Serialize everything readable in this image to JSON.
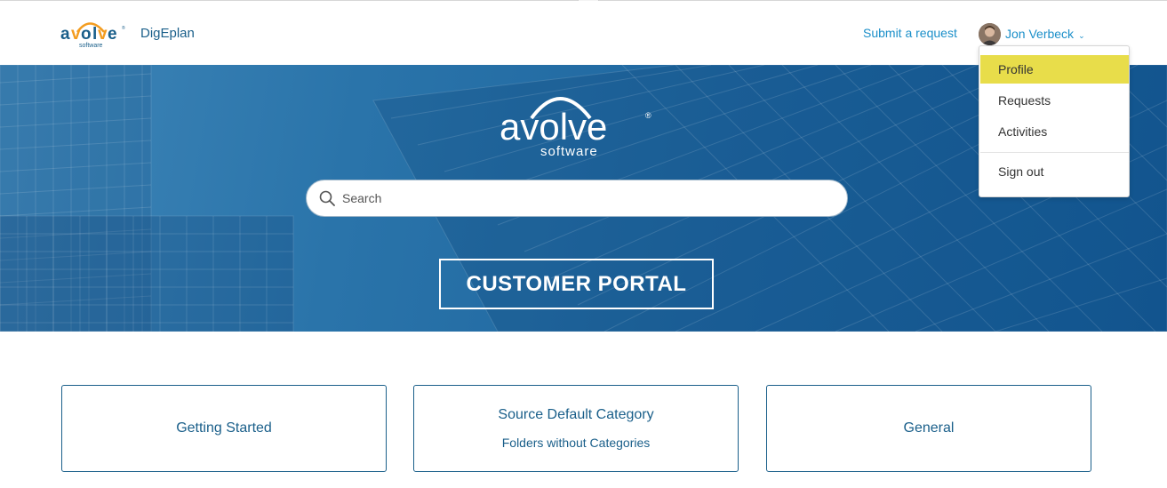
{
  "header": {
    "brand_name": "DigEplan",
    "submit_request": "Submit a request",
    "user_name": "Jon Verbeck"
  },
  "logo": {
    "wordmark": "avolve",
    "tagline": "software"
  },
  "hero": {
    "search_placeholder": "Search",
    "portal_title": "CUSTOMER PORTAL"
  },
  "user_dropdown": {
    "items": [
      {
        "label": "Profile",
        "highlighted": true
      },
      {
        "label": "Requests"
      },
      {
        "label": "Activities"
      },
      {
        "label": "Sign out"
      }
    ]
  },
  "categories": [
    {
      "title": "Getting Started"
    },
    {
      "title": "Source Default Category",
      "subtitle": "Folders without Categories"
    },
    {
      "title": "General"
    }
  ],
  "colors": {
    "link": "#1b8fc9",
    "brand_blue": "#1a5f8a",
    "logo_orange": "#f39c1f",
    "highlight": "#e8dd4a"
  }
}
